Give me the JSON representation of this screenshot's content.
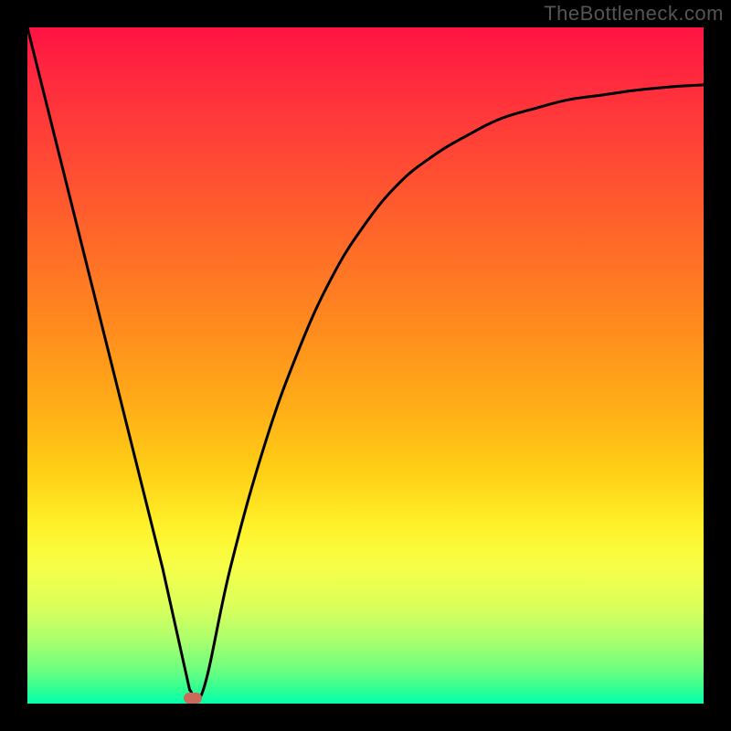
{
  "watermark": "TheBottleneck.com",
  "chart_data": {
    "type": "line",
    "title": "",
    "xlabel": "",
    "ylabel": "",
    "xlim": [
      0,
      1
    ],
    "ylim": [
      0,
      1
    ],
    "x": [
      0.0,
      0.05,
      0.1,
      0.15,
      0.2,
      0.24,
      0.26,
      0.3,
      0.35,
      0.4,
      0.45,
      0.5,
      0.55,
      0.6,
      0.65,
      0.7,
      0.75,
      0.8,
      0.85,
      0.9,
      0.95,
      1.0
    ],
    "values": [
      1.0,
      0.8,
      0.6,
      0.4,
      0.2,
      0.02,
      0.02,
      0.2,
      0.38,
      0.52,
      0.63,
      0.71,
      0.77,
      0.81,
      0.84,
      0.865,
      0.88,
      0.893,
      0.9,
      0.907,
      0.912,
      0.915
    ],
    "annotations": [
      {
        "type": "marker",
        "shape": "rounded-rect",
        "x": 0.245,
        "y": 0.008,
        "color": "#c96a5a"
      }
    ],
    "background": "vertical-gradient red→orange→yellow→green"
  },
  "colors": {
    "frame": "#000000",
    "curve": "#000000",
    "marker": "#c96a5a",
    "watermark": "#555555"
  }
}
